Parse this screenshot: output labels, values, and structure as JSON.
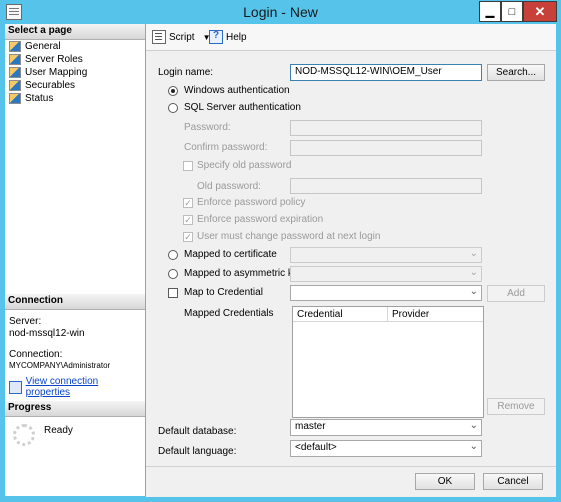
{
  "window": {
    "title": "Login - New",
    "minimize": "▁",
    "maximize": "□",
    "close": "✕"
  },
  "sidebar": {
    "select_page_header": "Select a page",
    "pages": [
      {
        "label": "General",
        "icon": "page-icon"
      },
      {
        "label": "Server Roles",
        "icon": "page-icon"
      },
      {
        "label": "User Mapping",
        "icon": "page-icon"
      },
      {
        "label": "Securables",
        "icon": "page-icon"
      },
      {
        "label": "Status",
        "icon": "page-icon"
      }
    ],
    "connection_header": "Connection",
    "server_label": "Server:",
    "server_value": "nod-mssql12-win",
    "connection_label": "Connection:",
    "connection_value": "MYCOMPANY\\Administrator",
    "view_connection_link": "View connection properties",
    "progress_header": "Progress",
    "progress_status": "Ready"
  },
  "toolbar": {
    "script_label": "Script",
    "help_label": "Help"
  },
  "form": {
    "login_name_label": "Login name:",
    "login_name_value": "NOD-MSSQL12-WIN\\OEM_User",
    "search_button": "Search...",
    "windows_auth_label": "Windows authentication",
    "sql_auth_label": "SQL Server authentication",
    "password_label": "Password:",
    "confirm_password_label": "Confirm password:",
    "specify_old_password_label": "Specify old password",
    "old_password_label": "Old password:",
    "enforce_policy_label": "Enforce password policy",
    "enforce_expiration_label": "Enforce password expiration",
    "must_change_label": "User must change password at next login",
    "mapped_cert_label": "Mapped to certificate",
    "mapped_asym_label": "Mapped to asymmetric key",
    "map_credential_label": "Map to Credential",
    "add_button": "Add",
    "mapped_credentials_label": "Mapped Credentials",
    "col_credential": "Credential",
    "col_provider": "Provider",
    "remove_button": "Remove",
    "default_database_label": "Default database:",
    "default_database_value": "master",
    "default_language_label": "Default language:",
    "default_language_value": "<default>"
  },
  "footer": {
    "ok_button": "OK",
    "cancel_button": "Cancel"
  }
}
